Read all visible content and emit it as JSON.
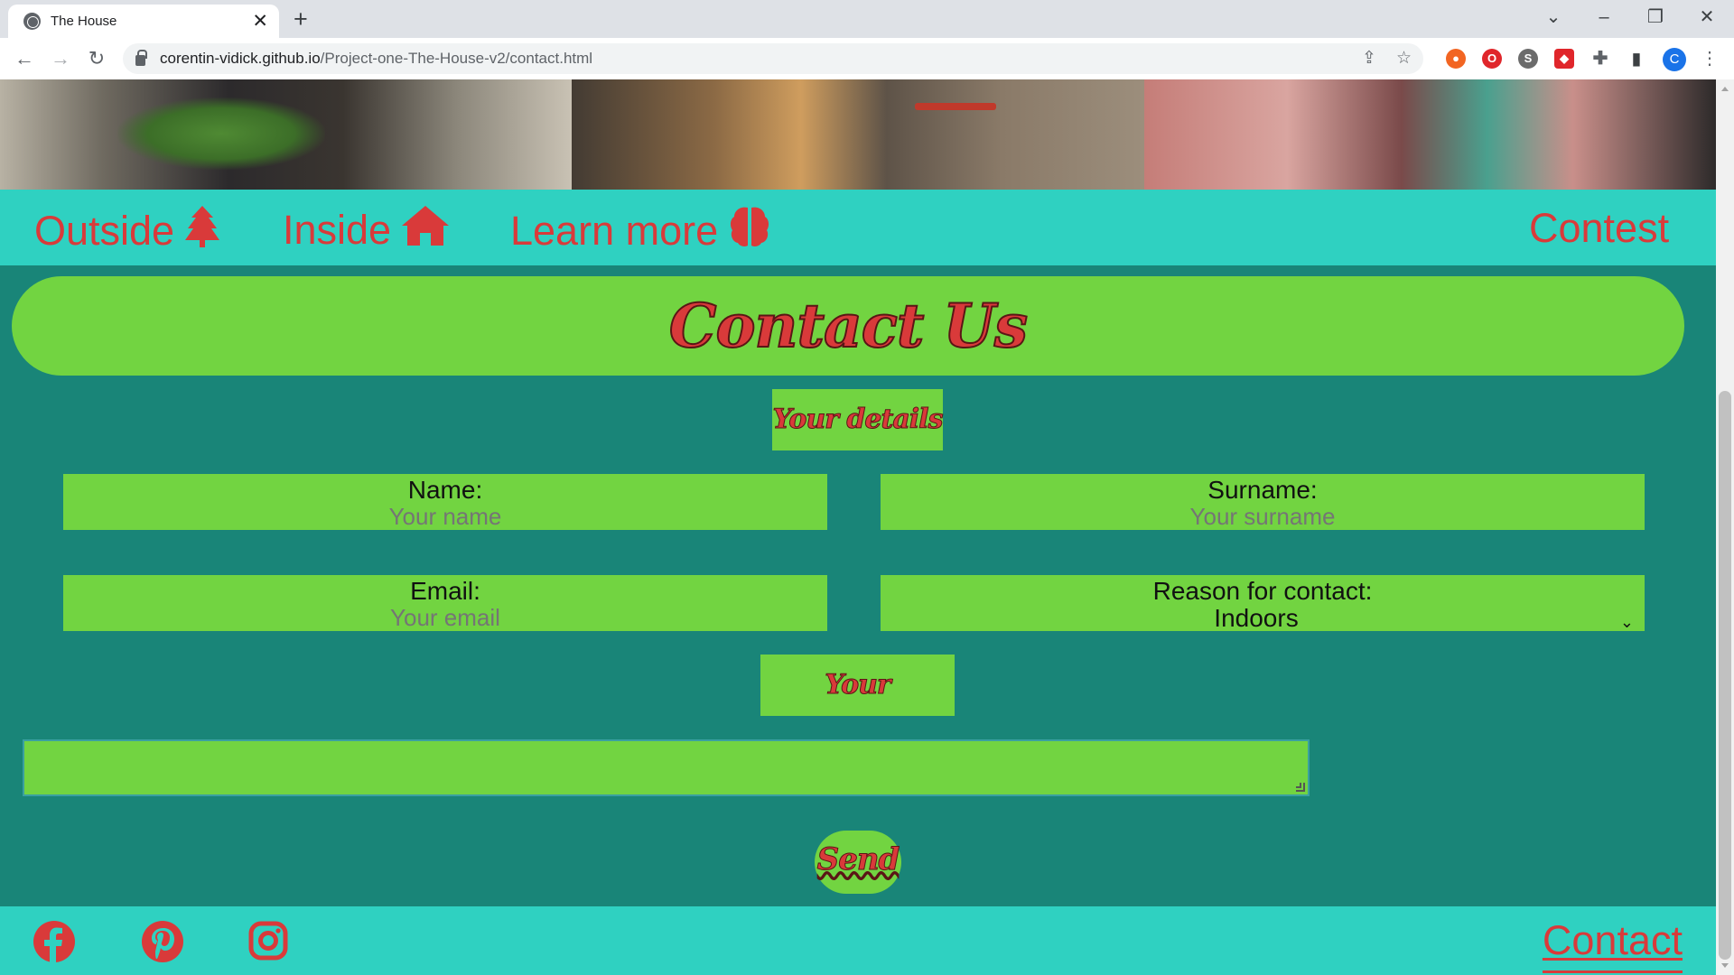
{
  "browser": {
    "tab_title": "The House",
    "tab_close": "✕",
    "new_tab": "+",
    "url_host": "corentin-vidick.github.io",
    "url_path": "/Project-one-The-House-v2/contact.html",
    "profile_initial": "C"
  },
  "nav": {
    "outside": "Outside",
    "inside": "Inside",
    "learn_more": "Learn more",
    "contest": "Contest"
  },
  "page": {
    "title": "Contact Us",
    "details_heading": "Your details",
    "message_heading": "Your message",
    "send_label": "Send"
  },
  "form": {
    "name": {
      "label": "Name:",
      "placeholder": "Your name"
    },
    "surname": {
      "label": "Surname:",
      "placeholder": "Your surname"
    },
    "email": {
      "label": "Email:",
      "placeholder": "Your email"
    },
    "reason": {
      "label": "Reason for contact:",
      "selected": "Indoors"
    }
  },
  "footer": {
    "contact_link": "Contact",
    "social_icons": [
      "facebook-icon",
      "pinterest-icon",
      "instagram-icon"
    ]
  },
  "colors": {
    "background": "#198578",
    "nav_bar": "#2fd1c1",
    "accent_green": "#72d441",
    "link_red": "#d93a3a"
  }
}
